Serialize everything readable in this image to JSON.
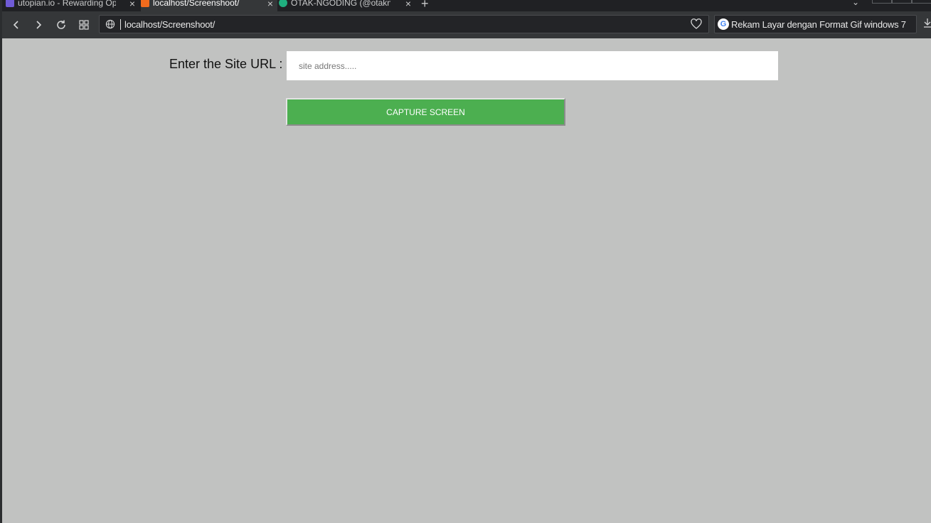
{
  "browser": {
    "tabs": [
      {
        "title": "utopian.io - Rewarding Open",
        "active": false
      },
      {
        "title": "localhost/Screenshoot/",
        "active": true
      },
      {
        "title": "OTAK-NGODING (@otakngoding",
        "active": false
      }
    ],
    "address": "localhost/Screenshoot/",
    "search_query": "Rekam Layar dengan Format Gif windows 7",
    "icons": {
      "back": "chevron-left-icon",
      "forward": "chevron-right-icon",
      "reload": "reload-icon",
      "speed_dial": "grid-icon",
      "site_info": "globe-icon",
      "bookmark": "heart-icon",
      "search_engine": "google-icon",
      "downloads": "download-icon"
    }
  },
  "form": {
    "label": "Enter the Site URL :",
    "input_placeholder": "site address.....",
    "input_value": "",
    "button_label": "CAPTURE SCREEN"
  },
  "colors": {
    "page_background": "#c1c2c1",
    "button_background": "#4caf50",
    "toolbar_background": "#353739"
  }
}
